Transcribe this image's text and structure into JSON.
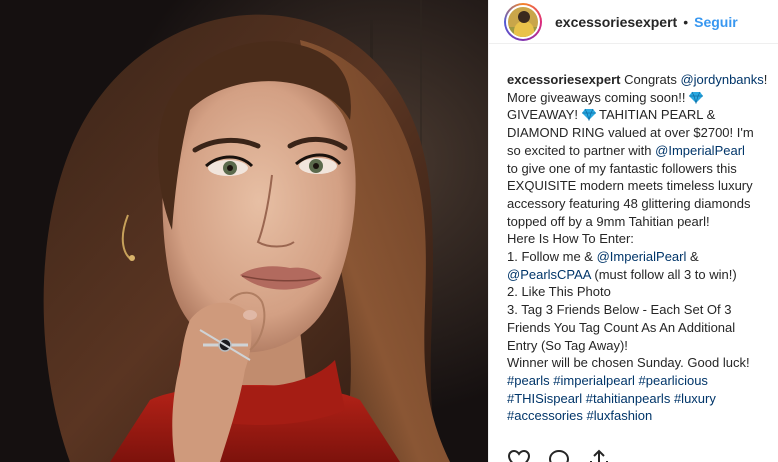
{
  "post": {
    "username": "excessoriesexpert",
    "separator": "•",
    "follow_label": "Seguir"
  },
  "caption": {
    "username": "excessoriesexpert",
    "lines": [
      " Congrats ",
      "@jordynbanks",
      "!",
      "More giveaways coming soon!! ",
      "GIVEAWAY! ",
      " TAHITIAN PEARL &",
      "DIAMOND RING valued at over $2700! I'm",
      "so excited to partner with ",
      "@ImperialPearl",
      "to give one of my fantastic followers this",
      "EXQUISITE modern meets timeless luxury",
      "accessory featuring 48 glittering diamonds",
      "topped off by a 9mm Tahitian pearl!",
      "Here Is How To Enter:",
      "1. Follow me & ",
      "@ImperialPearl",
      " &",
      "@PearlsCPAA",
      " (must follow all 3 to win!)",
      "2. Like This Photo",
      "3. Tag 3 Friends Below - Each Set Of 3",
      "Friends You Tag Count As An Additional",
      "Entry (So Tag Away)!",
      "Winner will be chosen Sunday. Good luck!"
    ],
    "hashtags": [
      "#pearls",
      "#imperialpearl",
      "#pearlicious",
      "#THISispearl",
      "#tahitianpearls",
      "#luxury",
      "#accessories",
      "#luxfashion"
    ]
  },
  "icons": {
    "gem": "gem-stone-icon",
    "like": "heart-icon",
    "comment": "comment-icon",
    "share": "share-icon"
  },
  "colors": {
    "link": "#003569",
    "follow": "#3897f0",
    "text": "#262626",
    "gem": "#29a8e0"
  }
}
